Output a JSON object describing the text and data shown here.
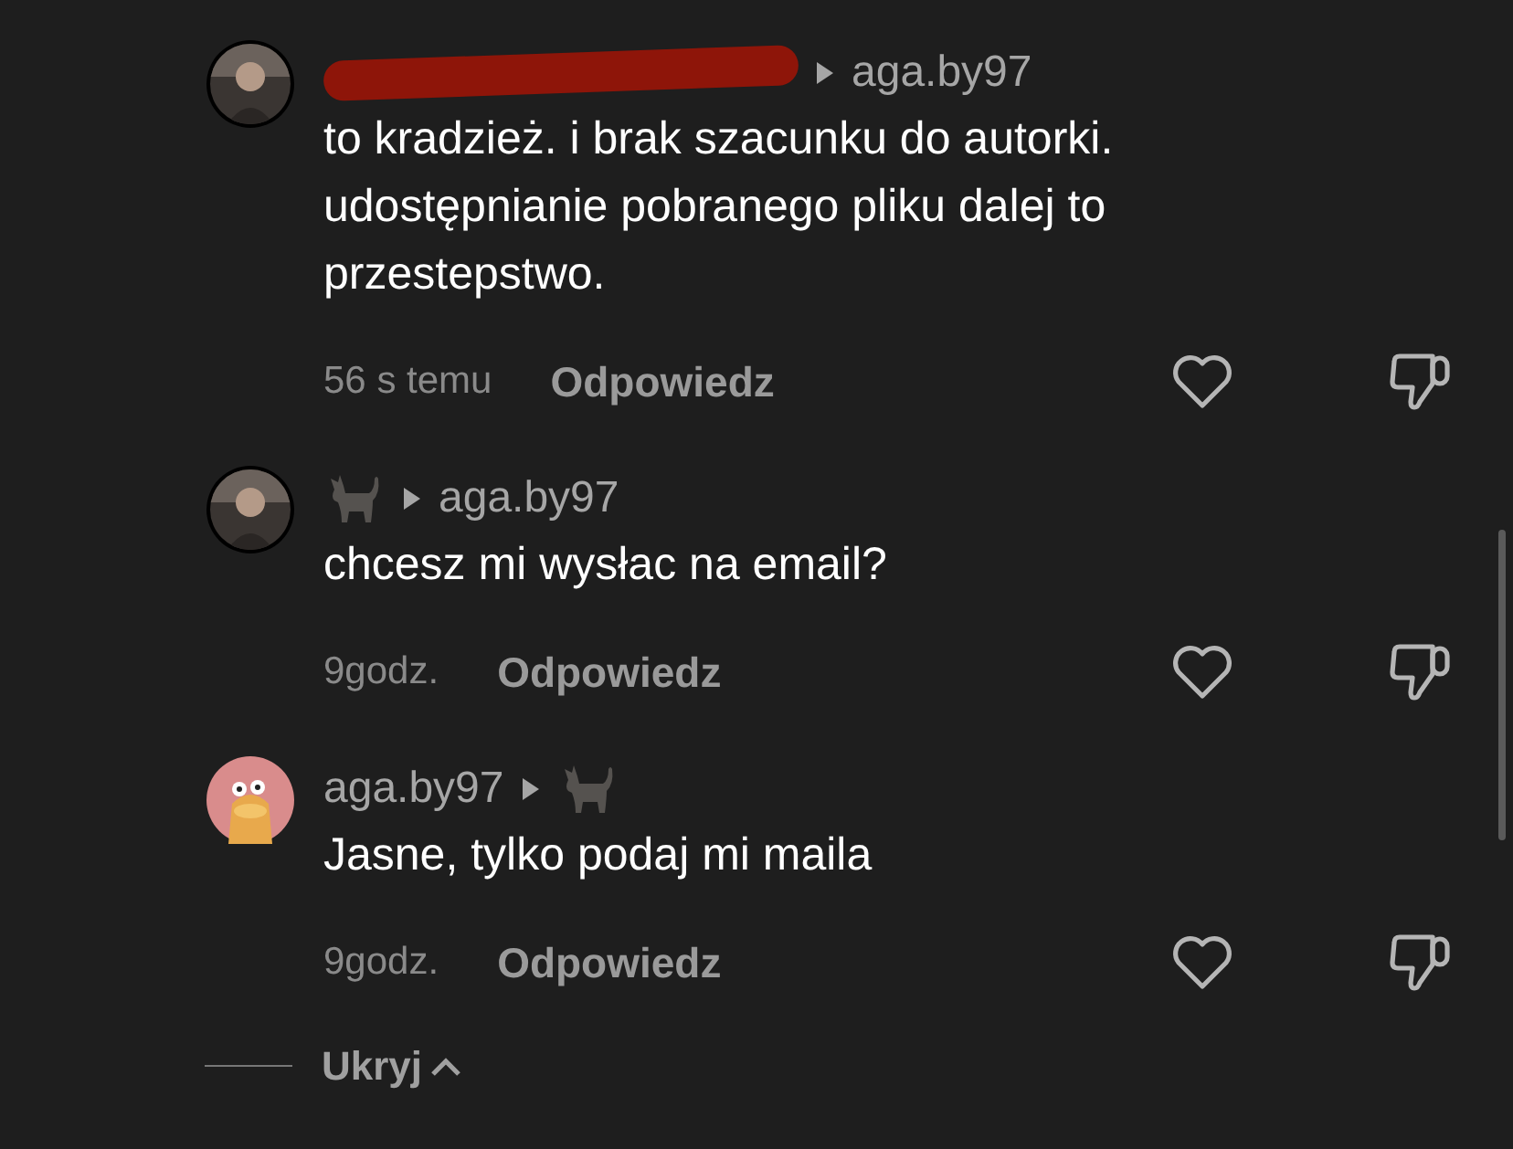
{
  "comments": [
    {
      "avatar": {
        "kind": "portrait"
      },
      "author": {
        "kind": "redacted"
      },
      "reply_to": {
        "kind": "text",
        "name": "aga.by97"
      },
      "text": "to kradzież. i brak szacunku do autorki. udostępnianie pobranego pliku dalej to przestepstwo.",
      "time": "56 s temu",
      "reply_label": "Odpowiedz"
    },
    {
      "avatar": {
        "kind": "portrait"
      },
      "author": {
        "kind": "cat"
      },
      "reply_to": {
        "kind": "text",
        "name": "aga.by97"
      },
      "text": "chcesz mi wysłac na email?",
      "time": "9godz.",
      "reply_label": "Odpowiedz"
    },
    {
      "avatar": {
        "kind": "cartoon"
      },
      "author": {
        "kind": "text",
        "name": "aga.by97"
      },
      "reply_to": {
        "kind": "cat"
      },
      "text": "Jasne, tylko podaj mi maila",
      "time": "9godz.",
      "reply_label": "Odpowiedz"
    }
  ],
  "hide_label": "Ukryj"
}
